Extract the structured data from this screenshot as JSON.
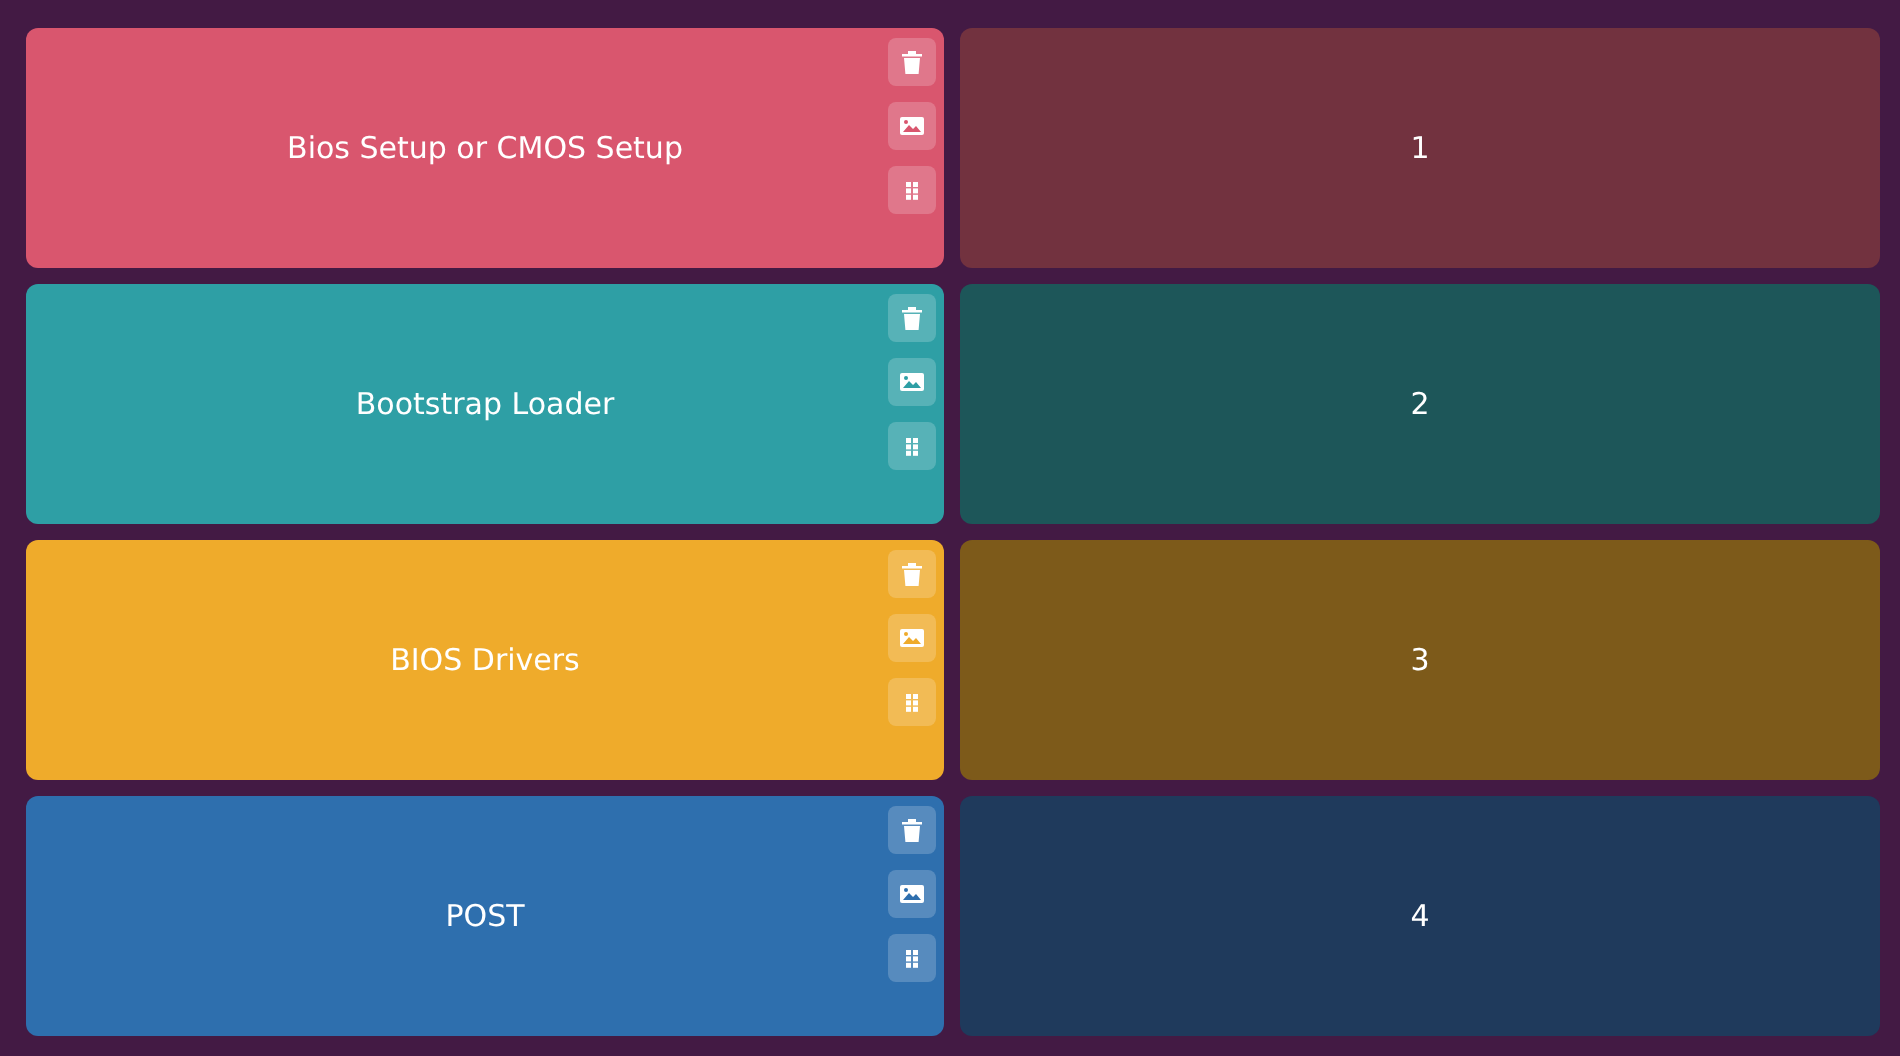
{
  "pairs": [
    {
      "card": {
        "label": "Bios Setup or CMOS Setup",
        "color": "#d9566e"
      },
      "answer": {
        "text": "1",
        "color": "#72323f"
      }
    },
    {
      "card": {
        "label": "Bootstrap Loader",
        "color": "#2e9fa5"
      },
      "answer": {
        "text": "2",
        "color": "#1d5659"
      }
    },
    {
      "card": {
        "label": "BIOS Drivers",
        "color": "#efab2b"
      },
      "answer": {
        "text": "3",
        "color": "#7d5a1a"
      }
    },
    {
      "card": {
        "label": "POST",
        "color": "#2e6fae"
      },
      "answer": {
        "text": "4",
        "color": "#1f3a5c"
      }
    }
  ]
}
